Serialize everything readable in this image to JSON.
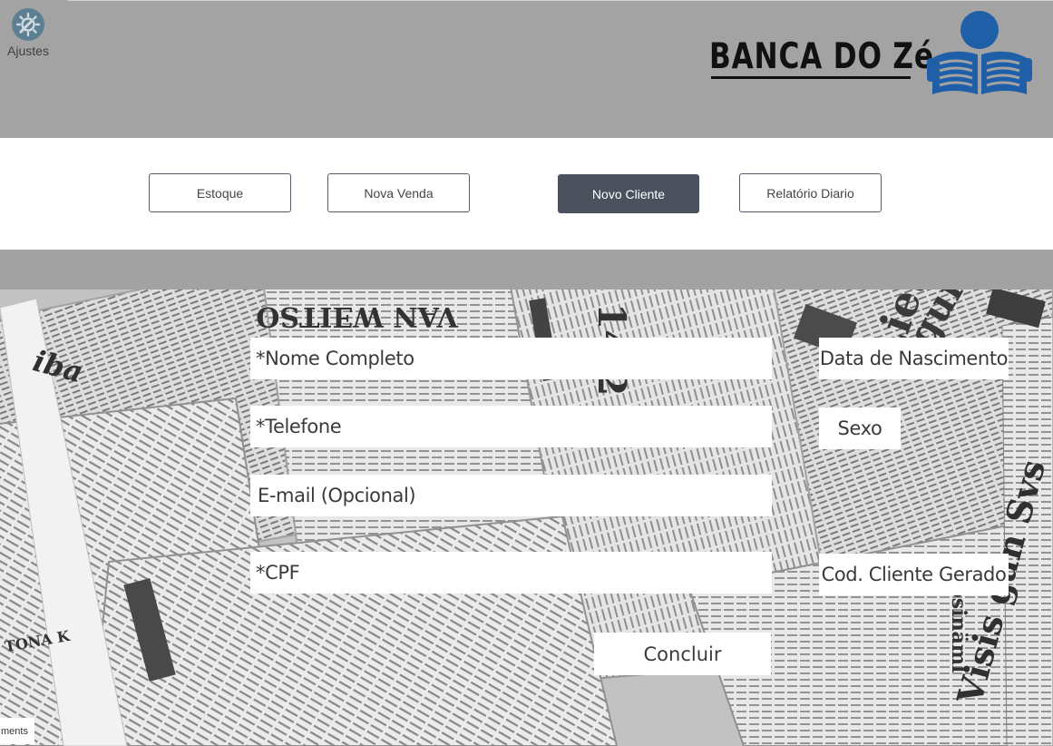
{
  "header": {
    "settings_label": "Ajustes",
    "brand_name": "BANCA DO Zé",
    "brand_color": "#111111",
    "logo_color": "#1f5fa8"
  },
  "nav": {
    "stock_label": "Estoque",
    "new_sale_label": "Nova Venda",
    "new_client_label": "Novo Cliente",
    "daily_report_label": "Relatório Diario",
    "active_color": "#4b525e"
  },
  "form": {
    "name_placeholder": "*Nome Completo",
    "phone_placeholder": "*Telefone",
    "email_placeholder": "E-mail (Opcional)",
    "cpf_placeholder": "*CPF",
    "birthdate_label": "Data de Nascimento",
    "sex_label": "Sexo",
    "client_code_label": "Cod. Cliente Gerado",
    "submit_label": "Concluir"
  },
  "background": {
    "headline_texts": [
      "VAN WƎITSO",
      "14.2",
      "Lietu",
      "guma",
      "iba",
      "ferosinäml",
      "Visis gan Svs",
      "TONA K"
    ]
  },
  "footer": {
    "tag_label": "ments"
  }
}
